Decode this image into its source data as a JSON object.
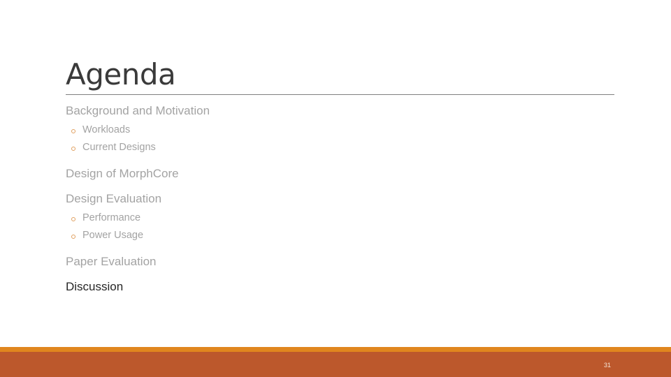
{
  "slide": {
    "title": "Agenda",
    "items": [
      {
        "label": "Background and Motivation",
        "current": false,
        "subitems": [
          "Workloads",
          "Current Designs"
        ]
      },
      {
        "label": "Design of MorphCore",
        "current": false,
        "subitems": []
      },
      {
        "label": "Design Evaluation",
        "current": false,
        "subitems": [
          "Performance",
          "Power Usage"
        ]
      },
      {
        "label": "Paper Evaluation",
        "current": false,
        "subitems": []
      },
      {
        "label": "Discussion",
        "current": true,
        "subitems": []
      }
    ],
    "bullet_icon": "hollow-circle-bullet",
    "page_number": "31"
  },
  "colors": {
    "title": "#3a3a3a",
    "inactive_text": "#a3a3a3",
    "active_text": "#262626",
    "bullet": "#e0a060",
    "footer_strip": "#e0861e",
    "footer_band": "#bc582c"
  }
}
